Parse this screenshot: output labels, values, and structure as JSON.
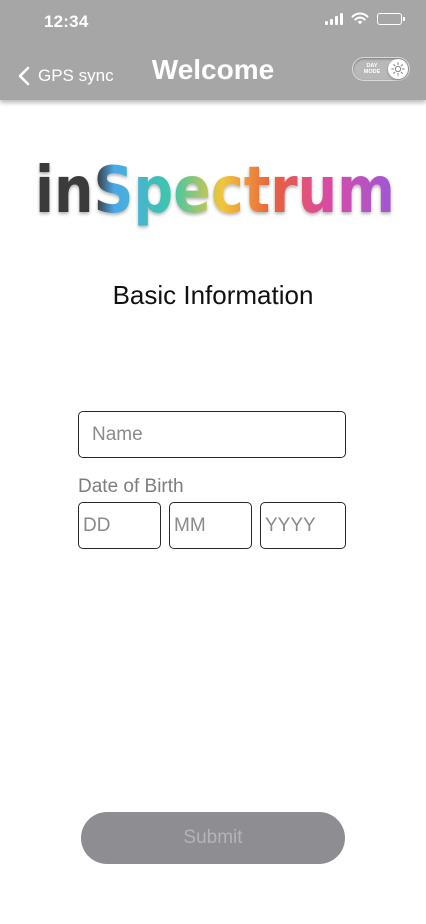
{
  "status_bar": {
    "time": "12:34"
  },
  "header": {
    "back_label": "GPS sync",
    "title": "Welcome",
    "mode_toggle": {
      "label_line1": "DAY",
      "label_line2": "MODE",
      "state": "day"
    }
  },
  "logo": {
    "text": "inSpectrum"
  },
  "form": {
    "heading": "Basic Information",
    "name": {
      "placeholder": "Name",
      "value": ""
    },
    "dob_label": "Date of Birth",
    "day": {
      "placeholder": "DD",
      "value": ""
    },
    "month": {
      "placeholder": "MM",
      "value": ""
    },
    "year": {
      "placeholder": "YYYY",
      "value": ""
    },
    "submit_label": "Submit"
  },
  "colors": {
    "header_bg": "#a6a6a6",
    "submit_bg": "#8e8e92",
    "logo_gradient": [
      "#3a3a3a",
      "#4aa8e8",
      "#3ec7a8",
      "#f2c53a",
      "#e8603c",
      "#d94aa8",
      "#9b59d6"
    ]
  },
  "icons": {
    "back": "chevron-left-icon",
    "signal": "cellular-signal-icon",
    "wifi": "wifi-icon",
    "battery": "battery-icon",
    "mode": "sun-icon"
  }
}
